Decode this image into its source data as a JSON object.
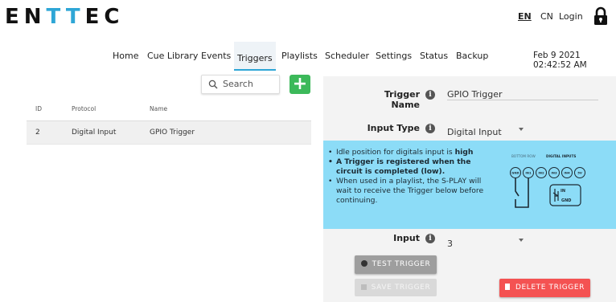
{
  "brand": {
    "logo_part1": "EN",
    "logo_part2": "TT",
    "logo_part3": "EC",
    "accent": "#2ea6d6"
  },
  "header": {
    "lang_en": "EN",
    "lang_cn": "CN",
    "login": "Login",
    "lock_icon": "lock-icon"
  },
  "nav": {
    "items": [
      "Home",
      "Cue Library",
      "Events",
      "Triggers",
      "Playlists",
      "Scheduler",
      "Settings",
      "Status",
      "Backup"
    ],
    "active": "Triggers",
    "datetime": "Feb 9 2021 02:42:52 AM"
  },
  "search": {
    "label": "Search",
    "icon": "search-icon"
  },
  "add_button": {
    "label": "+",
    "color": "#3cb95a"
  },
  "table": {
    "headers": {
      "id": "ID",
      "protocol": "Protocol",
      "name": "Name"
    },
    "rows": [
      {
        "id": "2",
        "protocol": "Digital Input",
        "name": "GPIO Trigger"
      }
    ]
  },
  "form": {
    "trigger_name_label": "Trigger Name",
    "trigger_name_value": "GPIO Trigger",
    "input_type_label": "Input Type",
    "input_type_value": "Digital Input",
    "input_label": "Input",
    "input_value": "3"
  },
  "info": {
    "line1_pre": "Idle position for digitals input is ",
    "line1_bold": "high",
    "line2_bold": "A Trigger is registered when the circuit is completed (low).",
    "line3": "When used in a playlist, the S-PLAY will wait to receive the Trigger below before continuing.",
    "diagram_title_a": "BOTTOM ROW",
    "diagram_title_b": "DIGITAL INPUTS",
    "pins": [
      "GND",
      "IN1",
      "IN2",
      "IN3",
      "IN4",
      "5V"
    ],
    "in_label": "IN",
    "gnd_label": "GND",
    "bg_color": "#8cdcf7"
  },
  "buttons": {
    "test": "TEST TRIGGER",
    "save": "SAVE TRIGGER",
    "delete": "DELETE TRIGGER",
    "delete_color": "#f45252"
  }
}
